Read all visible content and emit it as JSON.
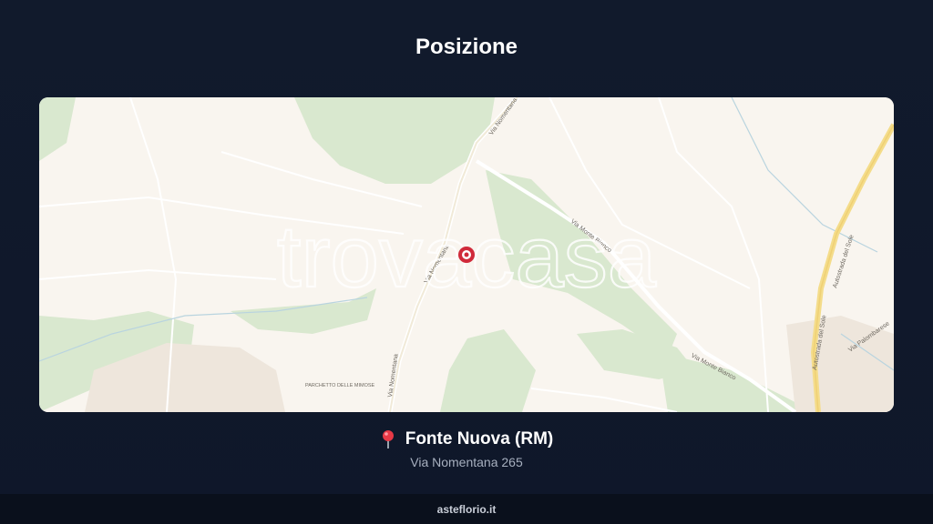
{
  "header": {
    "title": "Posizione"
  },
  "map": {
    "watermark": "trovacasa",
    "labels": {
      "via_nomentana_top": "Via Nomentana",
      "via_nomentana_mid": "Via Nomentana",
      "via_nomentana_bottom": "Via Nomentana",
      "via_monte_bianco_top": "Via Monte Bianco",
      "via_monte_bianco_bottom": "Via Monte Bianco",
      "autostrada_top": "Autostrada del Sole",
      "autostrada_bottom": "Autostrada del Sole",
      "via_palombarese": "Via Palombarese",
      "parchetto": "PARCHETTO DELLE MIMOSE"
    },
    "colors": {
      "background": "#f9f5ef",
      "park": "#d9e8cf",
      "motorway": "#f4dc8a",
      "marker": "#d02a3a"
    }
  },
  "location": {
    "name": "Fonte Nuova (RM)",
    "address": "Via Nomentana 265",
    "pin_icon": "round-pushpin-icon"
  },
  "footer": {
    "text": "asteflorio.it"
  }
}
